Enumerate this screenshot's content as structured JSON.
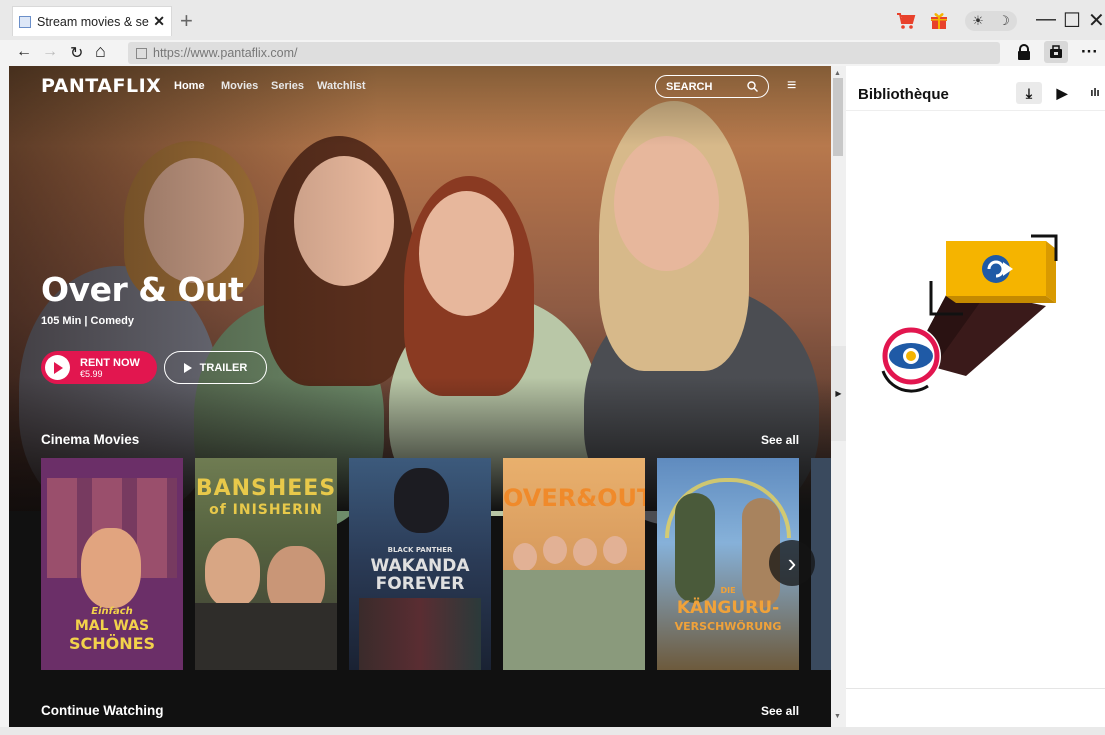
{
  "browser": {
    "tab_title": "Stream movies & seri",
    "tab_close": "✕",
    "new_tab": "+",
    "url": "https://www.pantaflix.com/",
    "theme_light": "☀",
    "theme_dark": "☽",
    "minimize": "—",
    "maximize": "☐",
    "close": "✕",
    "back": "←",
    "forward": "→",
    "reload": "↻",
    "home": "⌂",
    "more": "···"
  },
  "site": {
    "logo": "PANTAFLIX",
    "nav": [
      "Home",
      "Movies",
      "Series",
      "Watchlist"
    ],
    "search_label": "SEARCH",
    "hero": {
      "title": "Over & Out",
      "meta": "105 Min | Comedy",
      "rent_label": "RENT NOW",
      "rent_price": "€5.99",
      "trailer_label": "TRAILER"
    },
    "rows": {
      "cinema_title": "Cinema Movies",
      "continue_title": "Continue Watching",
      "see_all": "See all"
    },
    "posters": [
      {
        "name": "poster-mal-was-schones",
        "line1": "Einfach",
        "line2": "MAL WAS",
        "line3": "SCHÖNES",
        "bg": "#6b2f68",
        "fg": "#f2d24b"
      },
      {
        "name": "poster-banshees",
        "line1": "BANSHEES",
        "line2": "of INISHERIN",
        "line3": "",
        "bg": "#5e6a47",
        "fg": "#e8c94a"
      },
      {
        "name": "poster-wakanda",
        "line1": "BLACK PANTHER",
        "line2": "WAKANDA",
        "line3": "FOREVER",
        "bg": "#2a3a55",
        "fg": "#e0e0e0"
      },
      {
        "name": "poster-over-out",
        "line1": "OVER&OUT",
        "line2": "",
        "line3": "",
        "bg": "#d79a5d",
        "fg": "#f08a2a"
      },
      {
        "name": "poster-kanguru",
        "line1": "DIE",
        "line2": "KÄNGURU-",
        "line3": "VERSCHWÖRUNG",
        "bg": "#5f8bbf",
        "fg": "#f0a23a"
      }
    ]
  },
  "sidebar": {
    "title": "Bibliothèque",
    "tabs": [
      "⤓",
      "▶",
      "ılı"
    ]
  },
  "colors": {
    "accent": "#e2164f",
    "illus_yellow": "#f5b400",
    "illus_blue": "#1f5aa6"
  }
}
